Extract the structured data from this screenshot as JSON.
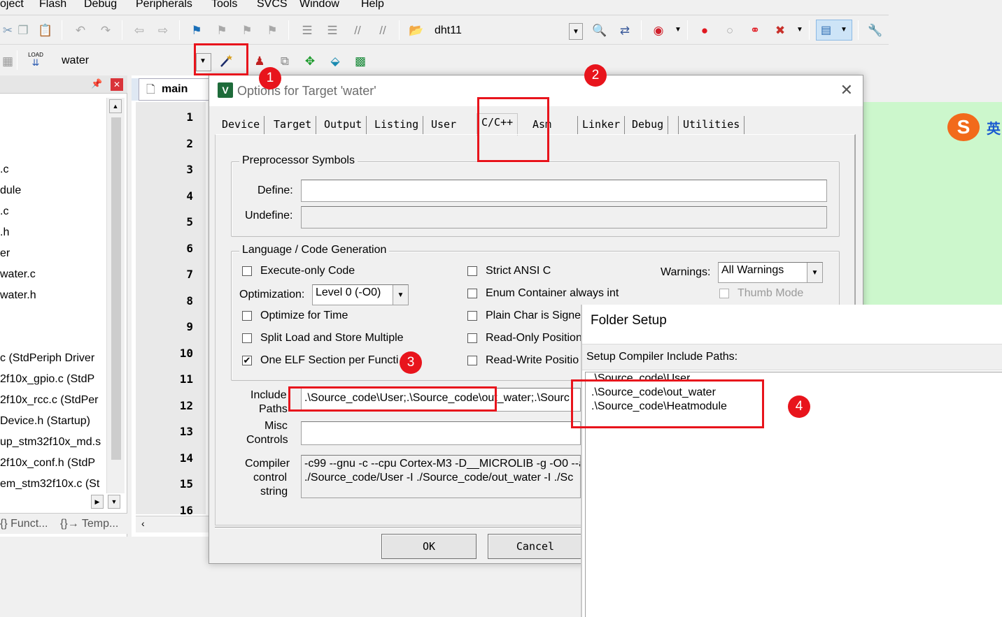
{
  "menu": [
    "oject",
    "Flash",
    "Debug",
    "Peripherals",
    "Tools",
    "SVCS",
    "Window",
    "Help"
  ],
  "toolbar": {
    "target_combo": "dht11",
    "project_target": "water",
    "load_label": "LOAD"
  },
  "project_tree": {
    "items": [
      ".c",
      "dule",
      ".c",
      ".h",
      "er",
      "water.c",
      "water.h",
      "c (StdPeriph Driver",
      "2f10x_gpio.c (StdP",
      "2f10x_rcc.c (StdPer",
      "Device.h (Startup)",
      "up_stm32f10x_md.s",
      "2f10x_conf.h (StdP",
      "em_stm32f10x.c (St"
    ],
    "tabs": [
      "{} Funct...",
      "{}→ Temp..."
    ]
  },
  "editor": {
    "tab": "main",
    "line_numbers": [
      "1",
      "2",
      "3",
      "4",
      "5",
      "6",
      "7",
      "8",
      "9",
      "10",
      "11",
      "12",
      "13",
      "14",
      "15",
      "16"
    ]
  },
  "dialog": {
    "title": "Options for Target 'water'",
    "tabs": [
      "Device",
      "Target",
      "Output",
      "Listing",
      "User",
      "C/C++",
      "Asm",
      "Linker",
      "Debug",
      "Utilities"
    ],
    "active_tab": "C/C++",
    "preprocessor": {
      "group_label": "Preprocessor Symbols",
      "define_label": "Define:",
      "define_value": "",
      "undefine_label": "Undefine:",
      "undefine_value": ""
    },
    "language": {
      "group_label": "Language / Code Generation",
      "execute_only": {
        "label": "Execute-only Code",
        "checked": false
      },
      "optimization_label": "Optimization:",
      "optimization_value": "Level 0 (-O0)",
      "optimize_time": {
        "label": "Optimize for Time",
        "checked": false
      },
      "split_load": {
        "label": "Split Load and Store Multiple",
        "checked": false
      },
      "one_elf": {
        "label": "One ELF Section per Functi",
        "checked": true
      },
      "strict_ansi": {
        "label": "Strict ANSI C",
        "checked": false
      },
      "enum_container": {
        "label": "Enum Container always int",
        "checked": false
      },
      "plain_char": {
        "label": "Plain Char is Signed",
        "checked": false
      },
      "ro_position": {
        "label": "Read-Only Position",
        "checked": false
      },
      "rw_position": {
        "label": "Read-Write Positio",
        "checked": false
      },
      "warnings_label": "Warnings:",
      "warnings_value": "All Warnings",
      "thumb_mode": {
        "label": "Thumb Mode",
        "checked": false
      }
    },
    "include_label_1": "Include",
    "include_label_2": "Paths",
    "include_value": ".\\Source_code\\User;.\\Source_code\\out_water;.\\Sourc",
    "misc_label_1": "Misc",
    "misc_label_2": "Controls",
    "misc_value": "",
    "compiler_label_1": "Compiler",
    "compiler_label_2": "control",
    "compiler_label_3": "string",
    "compiler_line_1": "-c99 --gnu -c --cpu Cortex-M3 -D__MICROLIB -g -O0 --a",
    "compiler_line_2": "./Source_code/User -I ./Source_code/out_water -I ./Sc",
    "ok_label": "OK",
    "cancel_label": "Cancel"
  },
  "folder_setup": {
    "title": "Folder Setup",
    "subtitle": "Setup Compiler Include Paths:",
    "paths": [
      ".\\Source_code\\User",
      ".\\Source_code\\out_water",
      ".\\Source_code\\Heatmodule"
    ]
  },
  "annotations": [
    "1",
    "2",
    "3",
    "4"
  ],
  "colors": {
    "annotation": "#e8141c",
    "editor_bg": "#ccf7cc"
  },
  "ime_label": "英"
}
